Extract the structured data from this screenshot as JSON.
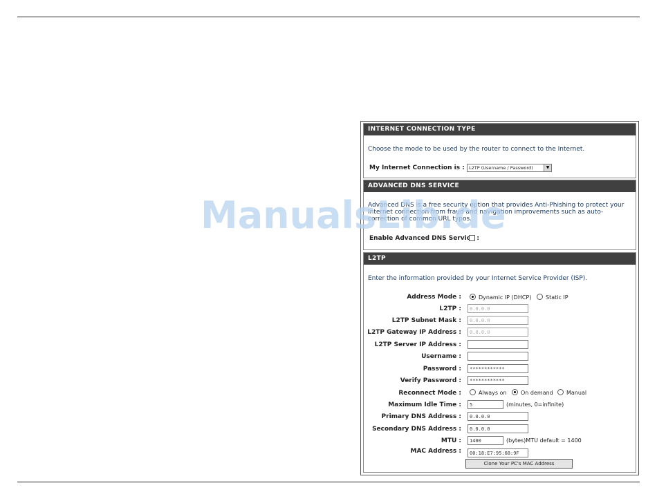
{
  "watermark": "ManualsLib.de",
  "internet_connection_type": {
    "header": "INTERNET CONNECTION TYPE",
    "description": "Choose the mode to be used by the router to connect to the Internet.",
    "connection_label": "My Internet Connection is :",
    "connection_value": "L2TP (Username / Password)"
  },
  "advanced_dns": {
    "header": "ADVANCED DNS SERVICE",
    "description": "Advanced DNS is a free security option that provides Anti-Phishing to protect your Internet connection from fraud and navigation improvements such as auto-correction of common URL typos.",
    "enable_label": "Enable Advanced DNS Service :",
    "enabled": false
  },
  "l2tp": {
    "header": "L2TP",
    "description": "Enter the information provided by your Internet Service Provider (ISP).",
    "address_mode": {
      "label": "Address Mode :",
      "options": [
        "Dynamic IP (DHCP)",
        "Static IP"
      ],
      "selected": "Dynamic IP (DHCP)"
    },
    "l2tp_ip": {
      "label": "L2TP :",
      "value": "0.0.0.0"
    },
    "subnet_mask": {
      "label": "L2TP Subnet Mask :",
      "value": "0.0.0.0"
    },
    "gateway": {
      "label": "L2TP Gateway IP Address :",
      "value": "0.0.0.0"
    },
    "server": {
      "label": "L2TP Server IP Address :",
      "value": ""
    },
    "username": {
      "label": "Username :",
      "value": ""
    },
    "password": {
      "label": "Password :",
      "value": "************"
    },
    "verify_password": {
      "label": "Verify Password :",
      "value": "************"
    },
    "reconnect_mode": {
      "label": "Reconnect Mode :",
      "options": [
        "Always on",
        "On demand",
        "Manual"
      ],
      "selected": "On demand"
    },
    "idle_time": {
      "label": "Maximum Idle Time :",
      "value": "5",
      "note": "(minutes, 0=infinite)"
    },
    "primary_dns": {
      "label": "Primary DNS Address :",
      "value": "0.0.0.0"
    },
    "secondary_dns": {
      "label": "Secondary DNS Address :",
      "value": "0.0.0.0"
    },
    "mtu": {
      "label": "MTU :",
      "value": "1400",
      "note": "(bytes)MTU default = 1400"
    },
    "mac": {
      "label": "MAC Address :",
      "value": "00:18:E7:95:68:9F"
    },
    "clone_button": "Clone Your PC's MAC Address"
  }
}
